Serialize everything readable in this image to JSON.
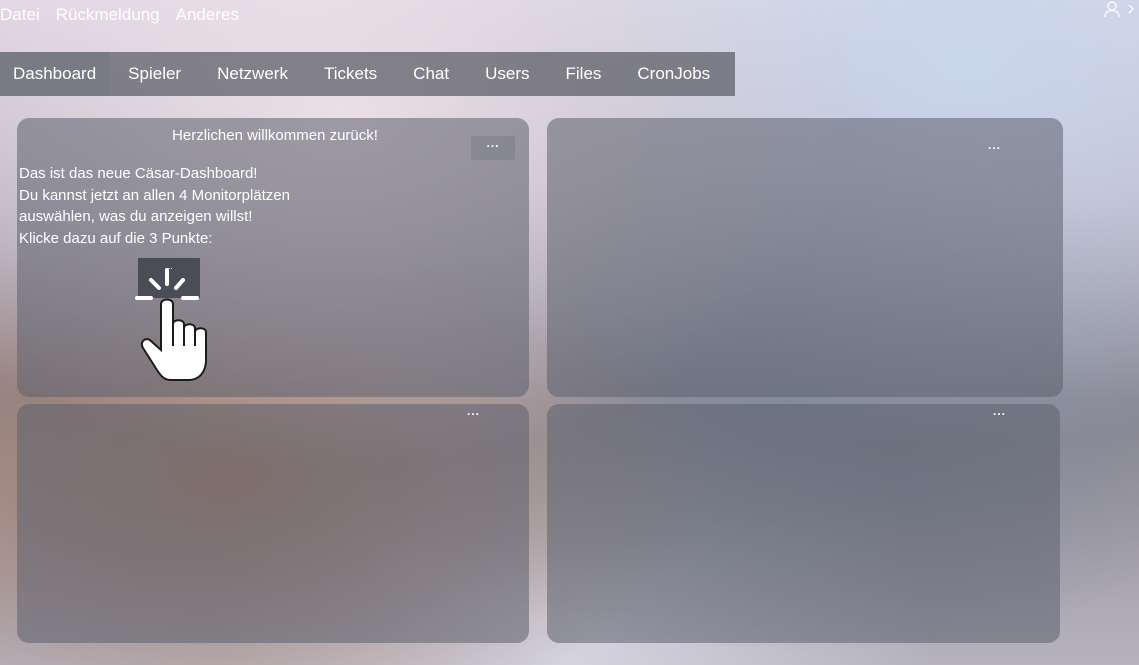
{
  "menubar": {
    "items": [
      {
        "label": "Datei"
      },
      {
        "label": "Rückmeldung"
      },
      {
        "label": "Anderes"
      }
    ]
  },
  "topright": {
    "user_icon": "user-icon",
    "expand_icon": "chevron-right-icon"
  },
  "tabs": [
    {
      "label": "Dashboard",
      "active": true
    },
    {
      "label": "Spieler"
    },
    {
      "label": "Netzwerk"
    },
    {
      "label": "Tickets"
    },
    {
      "label": "Chat"
    },
    {
      "label": "Users"
    },
    {
      "label": "Files"
    },
    {
      "label": "CronJobs"
    }
  ],
  "panels": {
    "welcome": {
      "title": "Herzlichen willkommen zurück!",
      "menu": "...",
      "lines": [
        "Das ist das neue Cäsar-Dashboard!",
        "Du kannst jetzt an allen 4 Monitorplätzen",
        "auswählen, was du anzeigen willst!",
        "Klicke dazu auf die 3 Punkte:"
      ],
      "demo_dots": "...",
      "hand_icon": "pointing-hand-click-icon"
    },
    "top_right": {
      "menu": "..."
    },
    "bottom_left": {
      "menu": "..."
    },
    "bottom_right": {
      "menu": "..."
    }
  },
  "colors": {
    "panel": "#5c606e",
    "tabbar": "#5a5c64",
    "text": "#ffffff"
  }
}
